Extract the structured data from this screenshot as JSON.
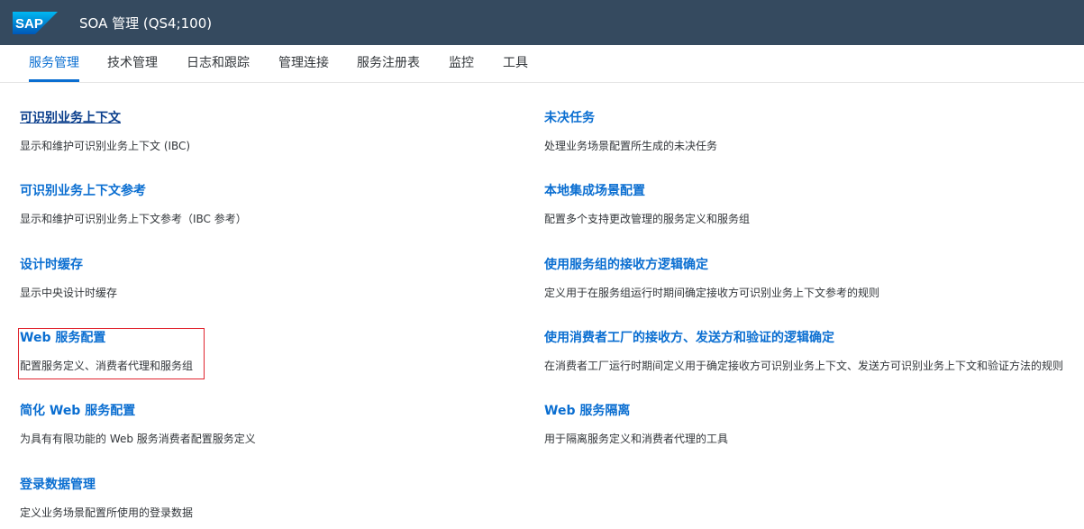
{
  "header": {
    "logo_text": "SAP",
    "title": "SOA 管理 (QS4;100)",
    "background_color": "#354a5f"
  },
  "tabs": [
    {
      "label": "服务管理",
      "active": true
    },
    {
      "label": "技术管理",
      "active": false
    },
    {
      "label": "日志和跟踪",
      "active": false
    },
    {
      "label": "管理连接",
      "active": false
    },
    {
      "label": "服务注册表",
      "active": false
    },
    {
      "label": "监控",
      "active": false
    },
    {
      "label": "工具",
      "active": false
    }
  ],
  "left_column": [
    {
      "title": "可识别业务上下文",
      "description": "显示和维护可识别业务上下文 (IBC)"
    },
    {
      "title": "可识别业务上下文参考",
      "description": "显示和维护可识别业务上下文参考（IBC 参考）"
    },
    {
      "title": "设计时缓存",
      "description": "显示中央设计时缓存"
    },
    {
      "title": "Web 服务配置",
      "description": "配置服务定义、消费者代理和服务组"
    },
    {
      "title": "简化 Web 服务配置",
      "description": "为具有有限功能的 Web 服务消费者配置服务定义"
    },
    {
      "title": "登录数据管理",
      "description": "定义业务场景配置所使用的登录数据"
    }
  ],
  "right_column": [
    {
      "title": "未决任务",
      "description": "处理业务场景配置所生成的未决任务"
    },
    {
      "title": "本地集成场景配置",
      "description": "配置多个支持更改管理的服务定义和服务组"
    },
    {
      "title": "使用服务组的接收方逻辑确定",
      "description": "定义用于在服务组运行时期间确定接收方可识别业务上下文参考的规则"
    },
    {
      "title": "使用消费者工厂的接收方、发送方和验证的逻辑确定",
      "description": "在消费者工厂运行时期间定义用于确定接收方可识别业务上下文、发送方可识别业务上下文和验证方法的规则"
    },
    {
      "title": "Web 服务隔离",
      "description": "用于隔离服务定义和消费者代理的工具"
    }
  ],
  "colors": {
    "link": "#0a6ed1",
    "text": "#32363a",
    "highlight": "#e0242e"
  }
}
